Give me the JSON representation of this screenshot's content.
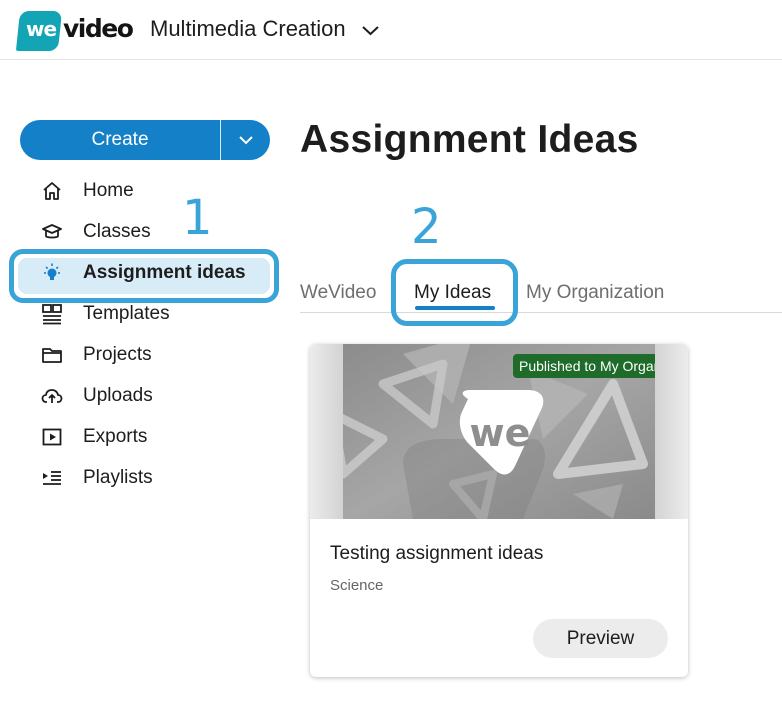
{
  "header": {
    "logo_mark": "we",
    "logo_word": "video",
    "workspace": "Multimedia Creation"
  },
  "sidebar": {
    "create_label": "Create",
    "items": [
      {
        "label": "Home",
        "icon": "home-icon"
      },
      {
        "label": "Classes",
        "icon": "graduation-cap-icon"
      },
      {
        "label": "Assignment ideas",
        "icon": "lightbulb-icon",
        "active": true
      },
      {
        "label": "Templates",
        "icon": "templates-icon"
      },
      {
        "label": "Projects",
        "icon": "folder-icon"
      },
      {
        "label": "Uploads",
        "icon": "cloud-upload-icon"
      },
      {
        "label": "Exports",
        "icon": "export-play-icon"
      },
      {
        "label": "Playlists",
        "icon": "playlist-icon"
      }
    ]
  },
  "annotations": {
    "step1": "1",
    "step2": "2",
    "color": "#3aa3d8"
  },
  "main": {
    "title": "Assignment Ideas",
    "tabs": [
      {
        "label": "WeVideo",
        "selected": false
      },
      {
        "label": "My Ideas",
        "selected": true
      },
      {
        "label": "My Organization",
        "selected": false
      }
    ],
    "card": {
      "badge": "Published to My Organization",
      "thumbnail_text": "we",
      "title": "Testing assignment ideas",
      "subject": "Science",
      "preview_label": "Preview"
    }
  },
  "colors": {
    "brand_teal": "#13a5b6",
    "primary_blue": "#1380c7",
    "active_bg": "#d8ecf8",
    "badge_green": "#1e6b2a"
  }
}
